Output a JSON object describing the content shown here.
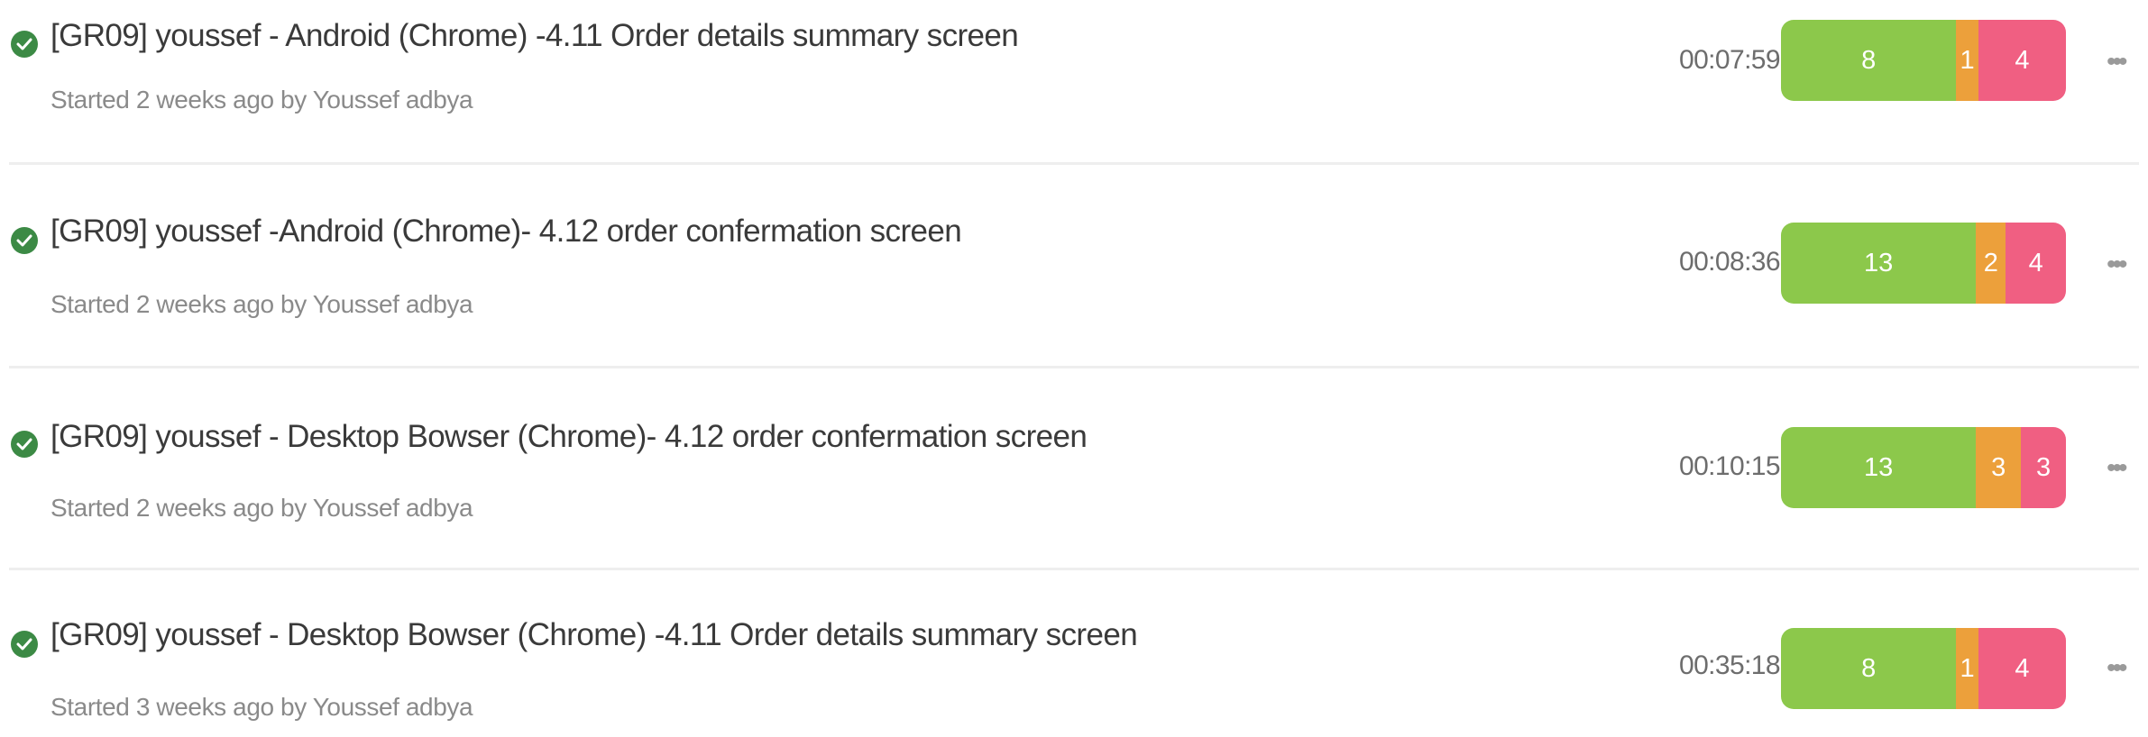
{
  "runs": [
    {
      "title": "[GR09] youssef - Android (Chrome) -4.11 Order details summary screen",
      "meta": "Started 2 weeks ago by Youssef adbya",
      "duration": "00:07:59",
      "results": {
        "passed": 8,
        "skipped": 1,
        "failed": 4
      },
      "more_label": "•••",
      "status_icon": "check-circle-icon"
    },
    {
      "title": "[GR09] youssef -Android (Chrome)- 4.12 order confermation screen",
      "meta": "Started 2 weeks ago by Youssef adbya",
      "duration": "00:08:36",
      "results": {
        "passed": 13,
        "skipped": 2,
        "failed": 4
      },
      "more_label": "•••",
      "status_icon": "check-circle-icon"
    },
    {
      "title": "[GR09] youssef - Desktop Bowser (Chrome)- 4.12 order confermation screen",
      "meta": "Started 2 weeks ago by Youssef adbya",
      "duration": "00:10:15",
      "results": {
        "passed": 13,
        "skipped": 3,
        "failed": 3
      },
      "more_label": "•••",
      "status_icon": "check-circle-icon"
    },
    {
      "title": "[GR09] youssef - Desktop Bowser (Chrome) -4.11 Order details summary screen",
      "meta": "Started 3 weeks ago by Youssef adbya",
      "duration": "00:35:18",
      "results": {
        "passed": 8,
        "skipped": 1,
        "failed": 4
      },
      "more_label": "•••",
      "status_icon": "check-circle-icon"
    }
  ],
  "colors": {
    "passed": "#8cc84b",
    "skipped": "#eca03b",
    "failed": "#f05f82",
    "success_icon": "#3c8a45"
  }
}
